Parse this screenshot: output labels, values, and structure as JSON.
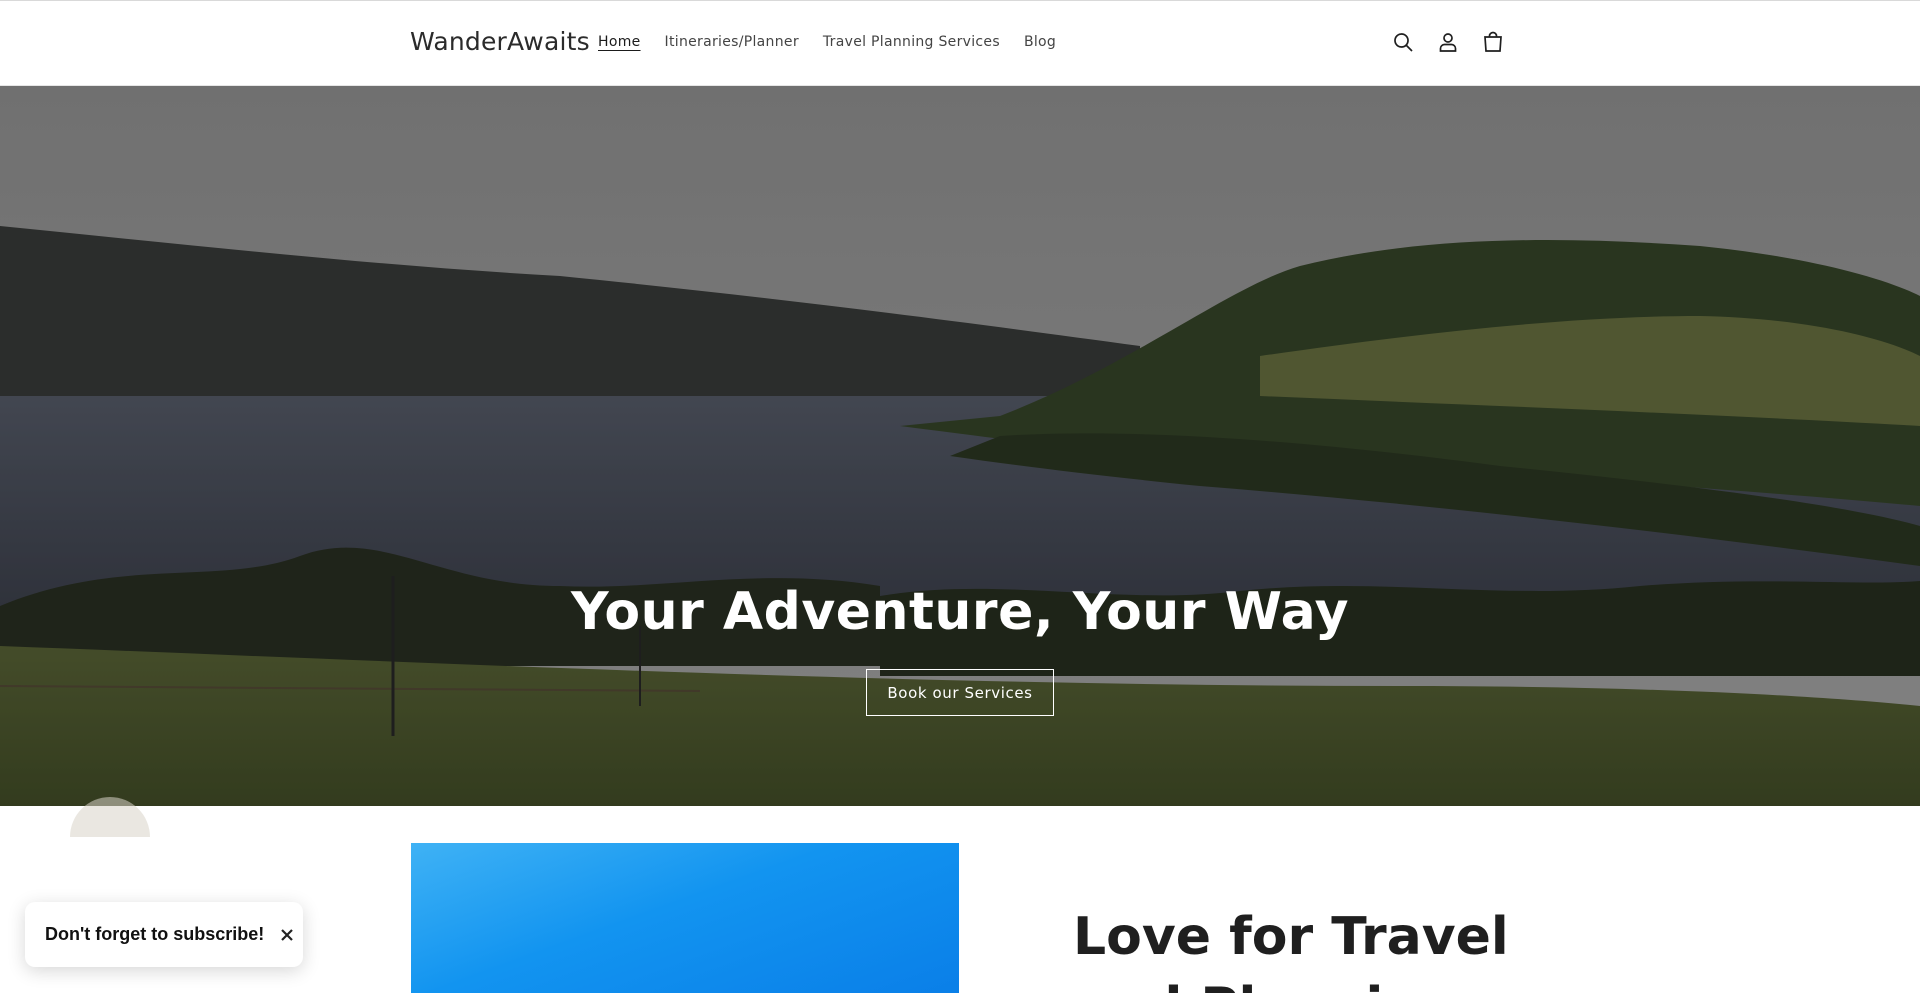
{
  "header": {
    "brand": "WanderAwaits",
    "nav": [
      {
        "label": "Home",
        "active": true
      },
      {
        "label": "Itineraries/Planner",
        "active": false
      },
      {
        "label": "Travel Planning Services",
        "active": false
      },
      {
        "label": "Blog",
        "active": false
      }
    ],
    "icons": [
      "search-icon",
      "account-icon",
      "cart-icon"
    ]
  },
  "hero": {
    "title": "Your Adventure, Your Way",
    "button_label": "Book our Services"
  },
  "feature": {
    "heading": "Love for Travel and Planning"
  },
  "toast": {
    "text": "Don't forget to subscribe!",
    "close_icon": "close-icon"
  }
}
